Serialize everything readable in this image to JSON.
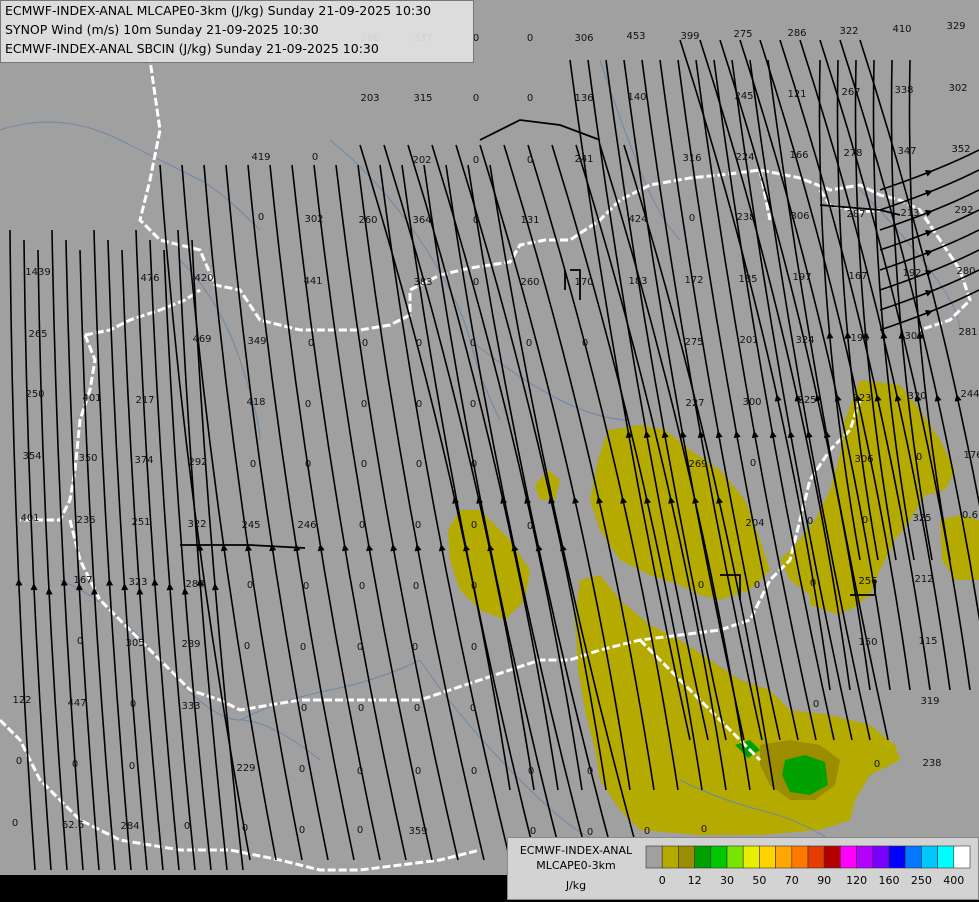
{
  "header": {
    "line1": "ECMWF-INDEX-ANAL MLCAPE0-3km (J/kg) Sunday 21-09-2025 10:30",
    "line2": "SYNOP Wind (m/s) 10m Sunday 21-09-2025 10:30",
    "line3": "ECMWF-INDEX-ANAL SBCIN (J/kg) Sunday 21-09-2025 10:30"
  },
  "legend": {
    "title_line1": "ECMWF-INDEX-ANAL",
    "title_line2": "MLCAPE0-3km",
    "unit": "J/kg",
    "colors": [
      "#a0a0a0",
      "#b4aa00",
      "#9c8c00",
      "#00a000",
      "#00c800",
      "#78e600",
      "#e6f000",
      "#ffd200",
      "#ffa500",
      "#ff7800",
      "#e63c00",
      "#b40000",
      "#ff00ff",
      "#b400ff",
      "#7800ff",
      "#0000ff",
      "#0078ff",
      "#00c8ff",
      "#00ffff",
      "#ffffff"
    ],
    "ticks": [
      "0",
      "12",
      "30",
      "50",
      "70",
      "90",
      "120",
      "160",
      "250",
      "400"
    ]
  },
  "colors": {
    "background": "#a0a0a0",
    "border": "#ffffff",
    "river": "#6e88a8",
    "cape_low": "#b4aa00",
    "cape_mid": "#9c8c00",
    "cape_green": "#00a000"
  },
  "labels": [
    "186",
    "337",
    "0",
    "0",
    "306",
    "453",
    "399",
    "275",
    "286",
    "322",
    "410",
    "329",
    "203",
    "315",
    "0",
    "0",
    "136",
    "140",
    "245",
    "121",
    "267",
    "338",
    "302",
    "419",
    "0",
    "202",
    "0",
    "0",
    "241",
    "316",
    "224",
    "166",
    "278",
    "347",
    "352",
    "0",
    "302",
    "260",
    "364",
    "0",
    "131",
    "424",
    "0",
    "238",
    "306",
    "287",
    "213",
    "292",
    "1439",
    "476",
    "420",
    "441",
    "383",
    "0",
    "260",
    "170",
    "183",
    "172",
    "185",
    "197",
    "167",
    "192",
    "280",
    "265",
    "469",
    "349",
    "0",
    "0",
    "0",
    "0",
    "0",
    "0",
    "275",
    "201",
    "324",
    "195",
    "306",
    "281",
    "250",
    "401",
    "217",
    "418",
    "0",
    "0",
    "0",
    "0",
    "227",
    "300",
    "225",
    "323",
    "320",
    "244",
    "354",
    "350",
    "374",
    "292",
    "0",
    "0",
    "0",
    "0",
    "0",
    "269",
    "0",
    "306",
    "0",
    "176",
    "401",
    "236",
    "251",
    "322",
    "245",
    "246",
    "0",
    "0",
    "0",
    "0",
    "204",
    "0",
    "0",
    "325",
    "0.6",
    "167",
    "323",
    "288",
    "0",
    "0",
    "0",
    "0",
    "0",
    "0",
    "0",
    "0",
    "256",
    "212",
    "0",
    "305",
    "289",
    "0",
    "0",
    "0",
    "0",
    "0",
    "150",
    "115",
    "122",
    "447",
    "0",
    "333",
    "0",
    "0",
    "0",
    "0",
    "0",
    "319",
    "0",
    "0",
    "0",
    "229",
    "0",
    "0",
    "0",
    "0",
    "0",
    "0",
    "0",
    "238",
    "0",
    "62.6",
    "284",
    "0",
    "0",
    "0",
    "0",
    "359",
    "0",
    "0",
    "0",
    "0"
  ]
}
